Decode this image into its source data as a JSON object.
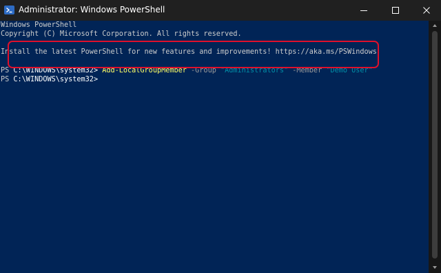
{
  "window": {
    "title": "Administrator: Windows PowerShell"
  },
  "console": {
    "lines": [
      "Windows PowerShell",
      "Copyright (C) Microsoft Corporation. All rights reserved.",
      "",
      "Install the latest PowerShell for new features and improvements! https://aka.ms/PSWindows",
      ""
    ],
    "prompt1": {
      "ps": "PS ",
      "path": "C:\\WINDOWS\\system32>",
      "cmdlet": "Add-LocalGroupMember",
      "param_group": "-Group",
      "group_value": "\"Administrators\"",
      "param_member": "-Member",
      "member_value": "\"Demo User\""
    },
    "prompt2": {
      "ps": "PS ",
      "path": "C:\\WINDOWS\\system32>"
    }
  },
  "icons": {
    "app": "powershell-icon",
    "minimize": "minimize-icon",
    "maximize": "maximize-icon",
    "close": "close-icon"
  },
  "colors": {
    "console_background": "#012456",
    "titlebar": "#202020",
    "cmdlet": "#ffff66",
    "string": "#008fa8",
    "parameter": "#9a9a9a",
    "highlight_box": "#e0102b"
  }
}
